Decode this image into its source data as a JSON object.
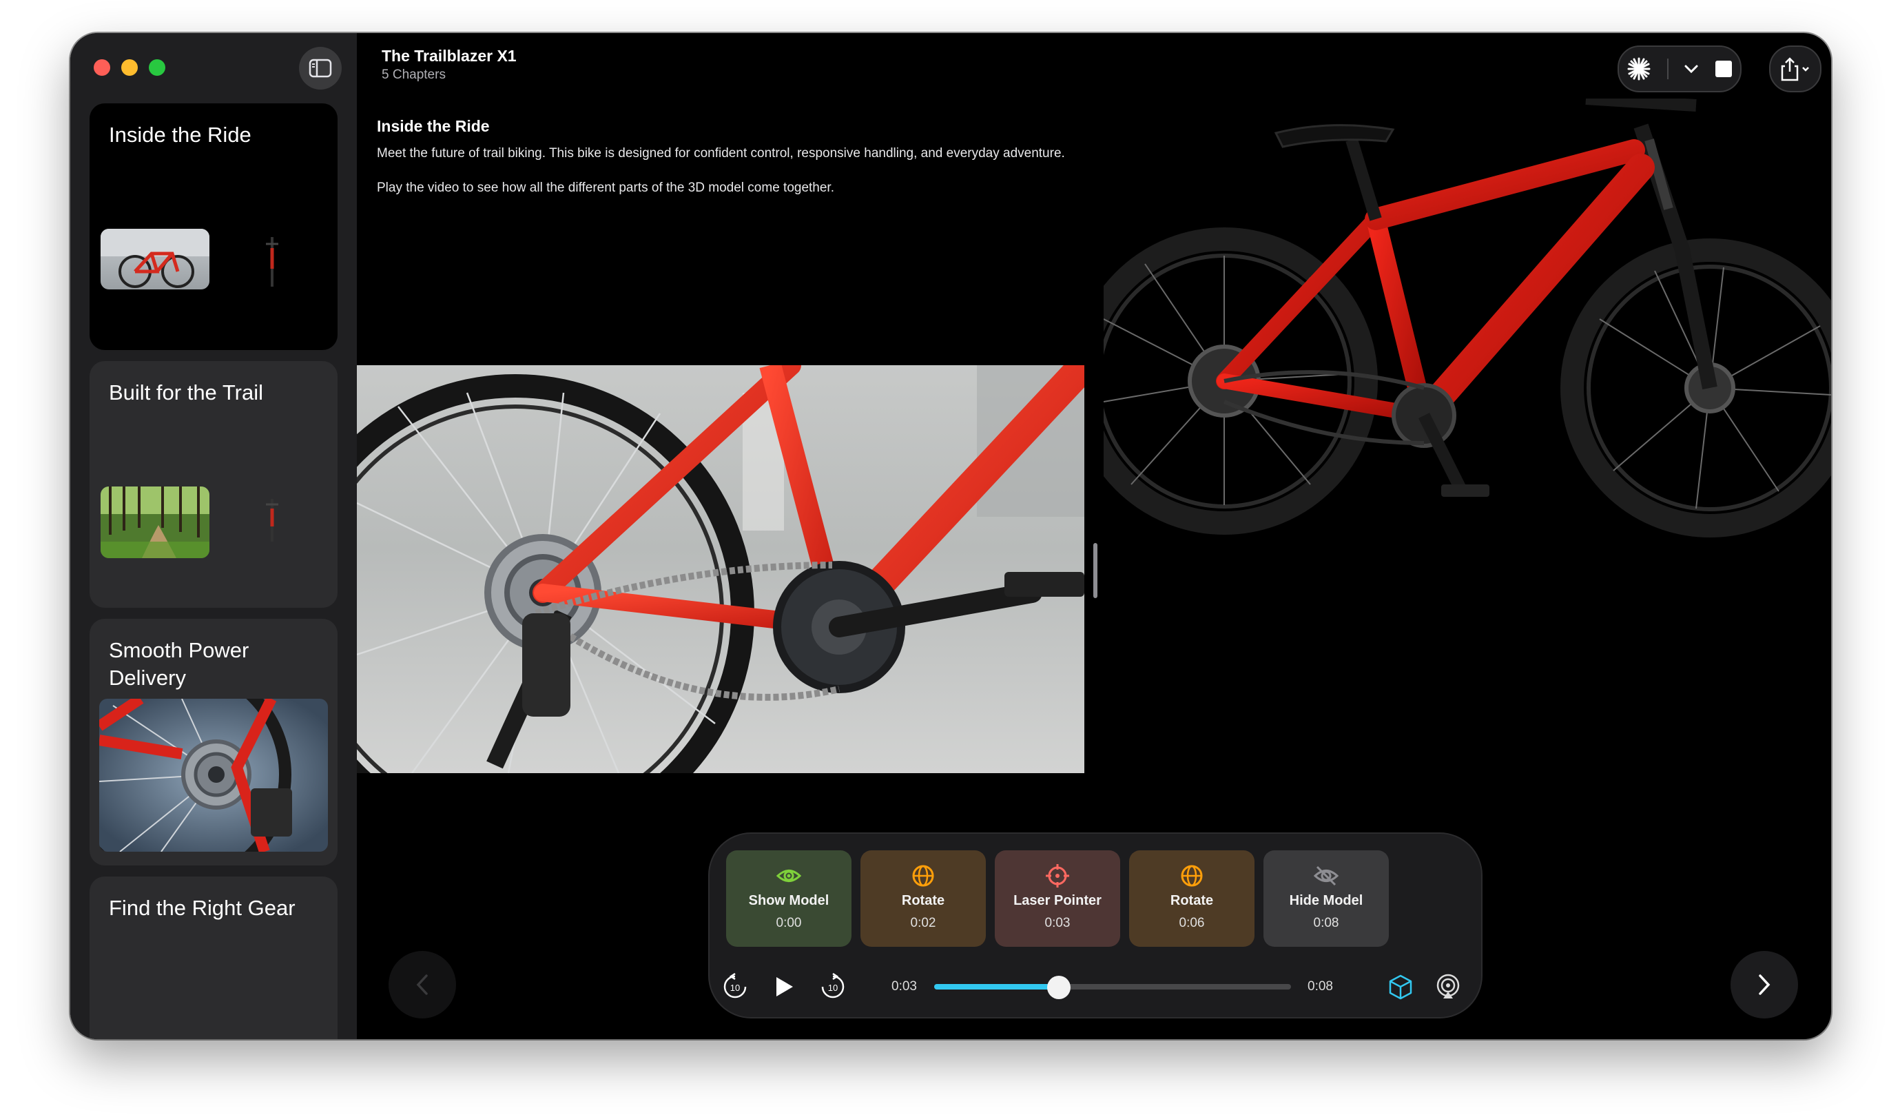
{
  "app": {
    "title": "The Trailblazer X1",
    "subtitle": "5 Chapters"
  },
  "sidebar": {
    "chapters": [
      {
        "title": "Inside the Ride",
        "active": true
      },
      {
        "title": "Built for the Trail",
        "active": false
      },
      {
        "title": "Smooth Power Delivery",
        "active": false
      },
      {
        "title": "Find the Right Gear",
        "active": false
      }
    ]
  },
  "content": {
    "heading": "Inside the Ride",
    "paragraph1": "Meet the future of trail biking. This bike is designed for confident control, responsive handling, and everyday adventure.",
    "paragraph2": "Play the video to see how all the different parts of the 3D model come together."
  },
  "timeline": {
    "actions": [
      {
        "label": "Show Model",
        "time": "0:00",
        "icon": "eye-icon",
        "color": "#3a4a33",
        "icon_color": "#7fd13b"
      },
      {
        "label": "Rotate",
        "time": "0:02",
        "icon": "rotate-icon",
        "color": "#4e3b25",
        "icon_color": "#ff9f0a"
      },
      {
        "label": "Laser Pointer",
        "time": "0:03",
        "icon": "laser-pointer-icon",
        "color": "#4e3634",
        "icon_color": "#ff6961"
      },
      {
        "label": "Rotate",
        "time": "0:06",
        "icon": "rotate-icon",
        "color": "#4e3b25",
        "icon_color": "#ff9f0a"
      },
      {
        "label": "Hide Model",
        "time": "0:08",
        "icon": "eye-slash-icon",
        "color": "#3a3a3c",
        "icon_color": "#8e8e93"
      }
    ],
    "current_time": "0:03",
    "total_time": "0:08",
    "progress": 0.35
  },
  "colors": {
    "accent": "#32c8f0",
    "background": "#000000",
    "sidebar": "#1f1f21"
  }
}
